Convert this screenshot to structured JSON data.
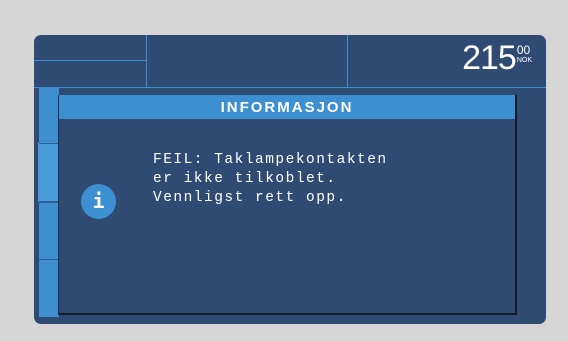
{
  "price": {
    "main": "215",
    "cents": "00",
    "currency": "NOK"
  },
  "dialog": {
    "title": "INFORMASJON",
    "icon": "info-icon",
    "message_lines": [
      "FEIL: Taklampekontakten",
      "er ikke tilkoblet.",
      "Vennligst rett opp."
    ]
  },
  "colors": {
    "background": "#d6d6d6",
    "screen": "#2f4a73",
    "accent": "#3c8fd0",
    "text": "#ffffff"
  }
}
